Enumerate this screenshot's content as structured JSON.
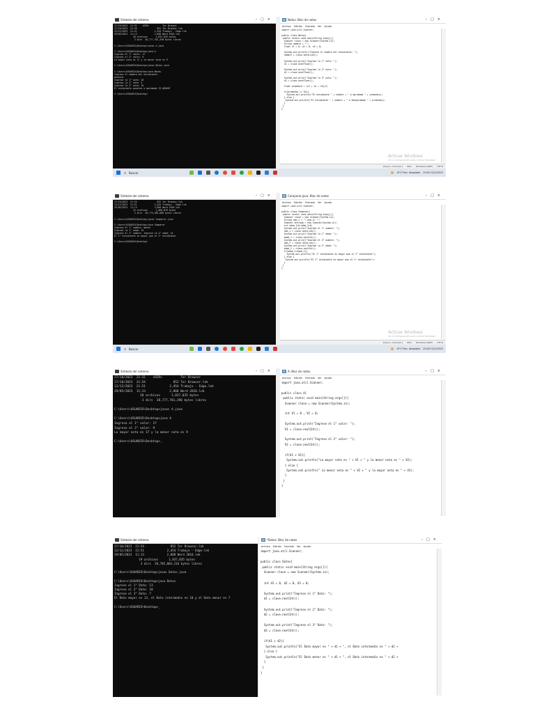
{
  "screenshots": [
    {
      "terminal_title": "Símbolo del sistema",
      "terminal_lines": [
        "27/10/2023  21:31    <DIR>          Tor Browser",
        "27/10/2023  21:54               852 Tor Browser.lnk",
        "12/12/2023  21:51             2,454 Trabajo - Edge.lnk",
        "29/05/2023  11:13             2,068 Word 2016.lnk",
        "              20 archivos      1,837,035 bytes",
        "               3 dirs  28,777,781,290 bytes libres",
        "",
        "C:\\Users\\USUARIO\\Desktop>javac A.java",
        "",
        "C:\\Users\\USUARIO\\Desktop>java A",
        "Ingrese el 1° valor: 17",
        "Ingrese el 2° valor: 9",
        "La mayor nota es 17 y la menor nota es 9",
        "",
        "C:\\Users\\USUARIO\\Desktop>javac Notas.java",
        "",
        "C:\\Users\\USUARIO\\Desktop>java Notas",
        "Ingrese el nombre del estudiante:",
        "panetos",
        "Ingrese la 1° nota: 10",
        "Ingrese la 2° nota: 5",
        "Ingrese la 3° nota: 16",
        "El estudiante panetos a aprobado 13.666667",
        "",
        "C:\\Users\\USUARIO\\Desktop>"
      ],
      "notepad_title": "Notas: Bloc de notas",
      "code_lines": [
        "import java.util.Scanner;",
        "",
        "public class Notas{",
        " public static void main(String args[]){",
        "  Scanner clave = new Scanner(System.in);",
        "  String nombre = \"\";",
        "  float n1 = 0, n2 = 0, n3 = 0;",
        "",
        "  System.out.println(\"Ingresa el nombre del estudiante: \");",
        "  nombre = clave.nextLine();",
        "",
        "  System.out.print(\"Ingrese la 1° nota: \");",
        "  n1 = clave.nextFloat();",
        "",
        "  System.out.print(\"Ingrese la 2° nota: \");",
        "  n2 = clave.nextFloat();",
        "",
        "  System.out.print(\"Ingrese la 3° nota: \");",
        "  n3 = clave.nextFloat();",
        "",
        "  float promedio = (n1 + n2 + n3)/3;",
        "",
        "  if(promedio >= 10){",
        "    System.out.println(\"El estudiante \" + nombre + \" a aprobado \" + promedio);",
        "  } else {",
        "   System.out.println(\"El estudiante \" + nombre + \" a desaprobado \" + promedio);",
        "  }",
        " }",
        "}"
      ],
      "status": [
        "Línea 1, columna 1",
        "90%",
        "Windows (CRLF)",
        "UTF-8"
      ],
      "taskbar": {
        "search": "Buscar",
        "weather": "19°C  Prac. despejado",
        "time": "20:06",
        "date": "12/12/2023"
      }
    },
    {
      "terminal_title": "Símbolo del sistema",
      "terminal_lines": [
        "27/10/2023  21:54               852 Tor Browser.lnk",
        "12/12/2023  21:51             2,454 Trabajo - Edge.lnk",
        "29/05/2023  11:13             2,068 Word 2016.lnk",
        "              32 archivos      1,866,870 bytes",
        "               3 dirs  28,775,585,800 bytes libres",
        "",
        "C:\\Users\\USUARIO\\Desktop>javac Comparar.java",
        "",
        "C:\\Users\\USUARIO\\Desktop>java Comparar",
        "Ingrese el 1° nombre: mateo",
        "Ingrese la 1° edad: 15",
        "Ingrese el 2° nombre: Ingrese la 2° edad: 14",
        "El 1° estudiante es mayor que el 2° estudiante",
        "",
        "C:\\Users\\USUARIO\\Desktop>"
      ],
      "notepad_title": "Comparar.java: Bloc de notas",
      "code_lines": [
        "import java.util.Scanner;",
        "",
        "public class Comparar{",
        " public static void main(String args[]){",
        "  Scanner clave = new Scanner(System.in);",
        "  String nom_1 = \"\",nom_2= \"\";",
        "  Scanner entrada = new Scanner(System.in);",
        "  int edad_1=0,edad_2=0;",
        "  System.out.print(\"Ingrese el 1° nombre: \");",
        "  nom_1 = clave.nextLine();",
        "  System.out.print(\"Ingrese la 1° edad: \");",
        "  edad_1 = clave.nextInt();",
        "  System.out.print(\"Ingrese el 2° nombre: \");",
        "  nom_2 = clave.nextLine();",
        "  System.out.print(\"Ingrese la 2° edad: \");",
        "  edad_2 = clave.nextInt();",
        "  if(edad_1>edad_2){",
        "    System.out.println(\"El 1° estudiante es mayor que el 2° estudiante\");",
        "  } else {",
        "   System.out.println(\"El 2° estudiante es mayor que el 1° estudiante\");",
        "  }",
        " }",
        "}"
      ],
      "status": [
        "Línea 1, columna 1",
        "90%",
        "Windows (CRLF)",
        "UTF-8"
      ],
      "taskbar": {
        "search": "Buscar",
        "weather": "19°C  Prac. despejado",
        "time": "20:08",
        "date": "12/12/2023"
      }
    },
    {
      "terminal_title": "Símbolo del sistema",
      "terminal_lines": [
        "27/10/2023  21:31    <DIR>          Tor Browser",
        "27/10/2023  21:54               852 Tor Browser.lnk",
        "12/12/2023  21:51             2,454 Trabajo - Edge.lnk",
        "29/05/2023  11:13             2,068 Word 2016.lnk",
        "              20 archivos      1,837,035 bytes",
        "               3 dirs  28,777,781,290 bytes libres",
        "",
        "C:\\Users\\USUARIO\\Desktop>javac A.java",
        "",
        "C:\\Users\\USUARIO\\Desktop>java A",
        "Ingrese el 1° valor: 17",
        "Ingrese el 2° valor: 9",
        "La mayor nota es 17 y la menor nota es 9",
        "",
        "C:\\Users\\USUARIO\\Desktop>_"
      ],
      "notepad_title": "A: Bloc de notas",
      "code_lines": [
        "import java.util.Scanner;",
        "",
        "public class A{",
        " public static void main(String args[]){",
        "  Scanner clave = new Scanner(System.in);",
        "",
        "  int V1 = 0 , V2 = 0;",
        "",
        "  System.out.print(\"Ingrese el 1° valor: \");",
        "  V1 = clave.nextInt();",
        "",
        "  System.out.print(\"Ingrese el 2° valor: \");",
        "  V2 = clave.nextInt();",
        "",
        "  if(V1 > V2){",
        "   System.out.println(\"La mayor nota es \" + V1 + \" y la menor nota es \" + V2);",
        "  } else {",
        "   System.out.println(\" La menor nota es \" + V2 + \" y la mayor nota es \" + V1);",
        "  }",
        " }",
        "}"
      ]
    },
    {
      "terminal_title": "Símbolo del sistema",
      "terminal_lines": [
        "27/10/2023  21:54               852 Tor Browser.lnk",
        "12/12/2023  21:51             2,454 Trabajo - Edge.lnk",
        "29/05/2023  11:13             2,068 Word 2016.lnk",
        "              19 archivos      1,837,035 bytes",
        "               3 dirs  28,785,083,216 bytes libres",
        "",
        "C:\\Users\\USUARIO\\Desktop>javac Datos.java",
        "",
        "C:\\Users\\USUARIO\\Desktop>java Datos",
        "Ingrese el 1° Dato: 13",
        "Ingrese el 2° Dato: 10",
        "Ingrese el 3° Dato: 7",
        "El Dato mayor es 13, el Dato intermedio es 10 y el Dato menor es 7",
        "",
        "C:\\Users\\USUARIO\\Desktop>_"
      ],
      "notepad_title": "*Datos: Bloc de notas",
      "code_lines": [
        "import java.util.Scanner;",
        "",
        "public class Datos{",
        " public static void main(String args[]){",
        "  Scanner clave = new Scanner(System.in);",
        "",
        "  int d1 = 0, d2 = 0, d3 = 0;",
        "",
        "  System.out.print(\"Ingrese el 1° Dato: \");",
        "  d1 = clave.nextInt();",
        "",
        "  System.out.print(\"Ingrese el 2° Dato: \");",
        "  d2 = clave.nextInt();",
        "",
        "  System.out.print(\"Ingrese el 3° Dato: \");",
        "  d3 = clave.nextInt();",
        "",
        "  if(d1 > d2){",
        "   System.out.println(\"El Dato mayor es \" + d1 + \", el Dato intermedio es \" + d2 +",
        "  } else {",
        "   System.out.println(\"El Dato menor es \" + d1 + \", el Dato intermedio es \" + d2 +",
        "  }",
        " }",
        "}"
      ]
    }
  ],
  "notepad_menu": [
    "Archivo",
    "Edición",
    "Formato",
    "Ver",
    "Ayuda"
  ],
  "watermark": {
    "title": "Activar Windows",
    "subtitle": "Ve a Configuración para activar Windows."
  }
}
